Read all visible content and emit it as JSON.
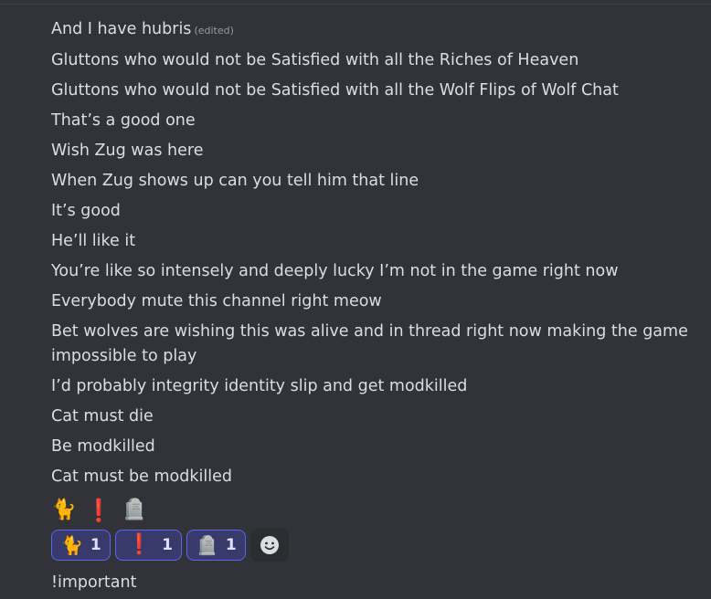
{
  "messages": [
    {
      "text": "And I have hubris",
      "edited": "(edited)"
    },
    {
      "text": "Gluttons who would not be Satisfied with all the Riches of Heaven"
    },
    {
      "text": "Gluttons who would not be Satisfied with all the Wolf Flips of Wolf Chat"
    },
    {
      "text": "That’s a good one"
    },
    {
      "text": "Wish Zug was here"
    },
    {
      "text": "When Zug shows up can you tell him that line"
    },
    {
      "text": "It’s good"
    },
    {
      "text": "He’ll like it"
    },
    {
      "text": "You’re like so intensely and deeply lucky I’m not in the game right now"
    },
    {
      "text": "Everybody mute this channel right meow"
    },
    {
      "text": "Bet wolves are wishing this was alive and in thread right now making the game impossible to play"
    },
    {
      "text": "I’d probably integrity identity slip and get modkilled"
    },
    {
      "text": "Cat must die"
    },
    {
      "text": "Be modkilled"
    },
    {
      "text": "Cat must be modkilled"
    }
  ],
  "emoji_message": {
    "emojis": [
      "🐈",
      "❗",
      "🪦"
    ]
  },
  "reactions": [
    {
      "emoji": "🐈",
      "icon": "cat-icon",
      "count": "1"
    },
    {
      "emoji": "❗",
      "icon": "exclamation-icon",
      "count": "1"
    },
    {
      "emoji": "🪦",
      "icon": "headstone-icon",
      "count": "1"
    }
  ],
  "last_message": {
    "text": "!important"
  },
  "colors": {
    "background": "#313338",
    "text": "#dbdee1",
    "reaction_border": "#5865f2",
    "reaction_bg": "#373a6a",
    "exclamation": "#e03c3c"
  }
}
